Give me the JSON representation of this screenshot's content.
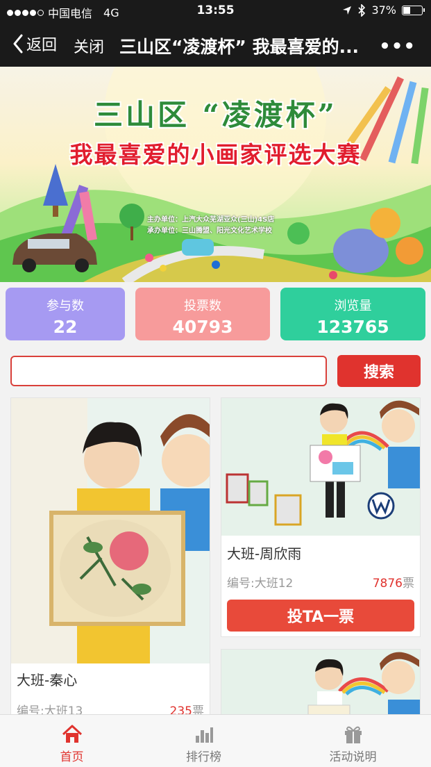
{
  "status_bar": {
    "carrier": "中国电信",
    "network": "4G",
    "time": "13:55",
    "battery": "37%",
    "battery_level": 0.37
  },
  "nav": {
    "back_label": "返回",
    "close_label": "关闭",
    "title": "三山区“凌渡杯” 我最喜爱的...",
    "more_label": "•••"
  },
  "banner": {
    "title_line1": "三山区 “凌渡杯”",
    "title_line2": "我最喜爱的小画家评选大赛",
    "organizer": "主办单位：上汽大众芜湖亚众(三山)4S店",
    "co_organizer": "承办单位：三山腾盟、阳光文化艺术学校"
  },
  "stats": {
    "participants_label": "参与数",
    "participants_value": "22",
    "votes_label": "投票数",
    "votes_value": "40793",
    "views_label": "浏览量",
    "views_value": "123765"
  },
  "search": {
    "placeholder": "",
    "button_label": "搜索"
  },
  "cards": [
    {
      "name": "大班-秦心",
      "number": "编号:大班13",
      "votes": "235",
      "votes_unit": "票"
    },
    {
      "name": "大班-周欣雨",
      "number": "编号:大班12",
      "votes": "7876",
      "votes_unit": "票",
      "vote_button": "投TA一票"
    }
  ],
  "tabs": {
    "home": "首页",
    "ranking": "排行榜",
    "rules": "活动说明"
  },
  "colors": {
    "accent": "#e0332e",
    "participants": "#a69af2",
    "votes": "#f79b9b",
    "views": "#2fcf9c"
  }
}
